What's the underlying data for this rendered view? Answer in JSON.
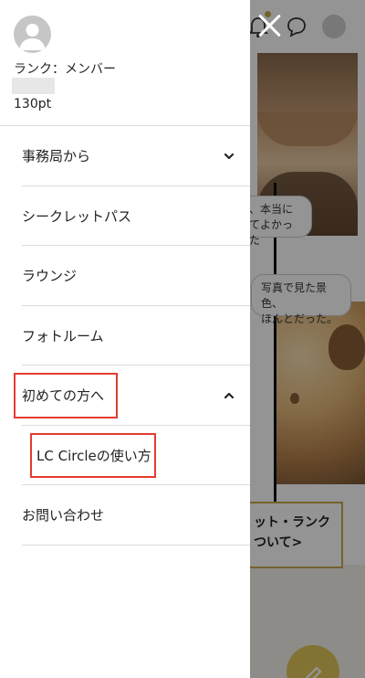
{
  "background_page": {
    "bubble1": "、本当に\nてよかった",
    "bubble2": "写真で見た景色、\nほんとだった。",
    "link_box_text": "ット・ランク\nついて>",
    "accent_color": "#c9a94a",
    "fab_icon": "pencil-icon",
    "header_icons": [
      "bell-icon",
      "chat-icon",
      "avatar"
    ]
  },
  "drawer": {
    "close_icon": "close-icon",
    "user": {
      "avatar_icon": "user-avatar-icon",
      "rank": "ランク：メンバー",
      "points": "130pt"
    },
    "menu": [
      {
        "label": "事務局から",
        "chevron": "chevron-down-icon"
      },
      {
        "label": "シークレットパス"
      },
      {
        "label": "ラウンジ"
      },
      {
        "label": "フォトルーム"
      },
      {
        "label": "初めての方へ",
        "chevron": "chevron-up-icon"
      },
      {
        "label": "LC Circleの使い方",
        "sub": true
      },
      {
        "label": "お問い合わせ"
      }
    ],
    "highlight_color": "#e53b30"
  }
}
